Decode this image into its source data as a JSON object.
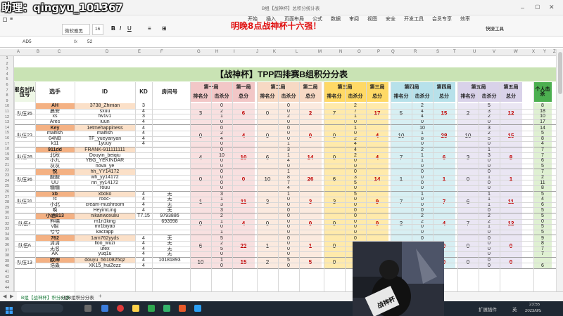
{
  "overlay": {
    "handle": "助理：qingyu_101367",
    "banner": "明晚8点战神杯十六强！"
  },
  "window": {
    "title": "B组【战神杯】总积分统计表",
    "menu": [
      "开始",
      "插入",
      "页面布局",
      "公式",
      "数据",
      "审阅",
      "视图",
      "安全",
      "开发工具",
      "会员专享",
      "效率"
    ]
  },
  "ribbon": {
    "font_name": "微软雅黑",
    "font_size": "16",
    "quick_tools": "快捷工具"
  },
  "formula_bar": {
    "cell_ref": "AD5",
    "fx": "fx",
    "value": "52"
  },
  "columns": [
    "A",
    "B",
    "C",
    "D",
    "E",
    "F",
    "G",
    "H",
    "I",
    "J",
    "K",
    "L",
    "M",
    "N",
    "O",
    "P",
    "Q",
    "R",
    "S",
    "T",
    "U",
    "V",
    "W",
    "X",
    "Y",
    "Z"
  ],
  "rows": [
    "1",
    "2",
    "3",
    "4",
    "5",
    "6",
    "7",
    "8",
    "9",
    "10",
    "11",
    "12",
    "13",
    "14",
    "15",
    "16",
    "17",
    "18",
    "19",
    "20",
    "21",
    "22",
    "23",
    "24",
    "25",
    "26",
    "27",
    "28",
    "29",
    "30",
    "31",
    "32",
    "33",
    "34",
    "35",
    "36",
    "37",
    "38",
    "39",
    "40",
    "41",
    "42",
    "43",
    "44"
  ],
  "sheet": {
    "title": "【战神杯】TPP四排赛B组积分分表",
    "headers": {
      "team_no": "报名时队伍号",
      "player": "选手",
      "id": "ID",
      "kd": "KD",
      "room": "房间号",
      "r1": "第一局",
      "r2": "第二局",
      "r3": "第三局",
      "r4": "第四局",
      "r5": "第五局",
      "rank_pts": "排名分",
      "kill_pts": "击杀分",
      "total": "总分",
      "personal": "个人击杀"
    },
    "teams": [
      {
        "name": "队伍35",
        "players": [
          [
            "AH",
            "3738_Zhinian",
            "3",
            ""
          ],
          [
            "晨安",
            "sxuu",
            "4",
            ""
          ],
          [
            "xs",
            "fw1v1",
            "3",
            ""
          ],
          [
            "Ares",
            "iuun",
            "4",
            ""
          ]
        ],
        "rounds": [
          [
            "3",
            "0 2 1 0",
            "6"
          ],
          [
            "0",
            "0 0 2 0",
            "2"
          ],
          [
            "7",
            "2 7 1 0",
            "17"
          ],
          [
            "5",
            "2 4 4 0",
            "15"
          ],
          [
            "2",
            "5 3 2 0",
            "12"
          ]
        ],
        "personal": [
          "8",
          "18",
          "10",
          "17"
        ]
      },
      {
        "name": "队伍23",
        "players": [
          [
            "Key",
            "1etmehappiness",
            "4",
            ""
          ],
          [
            "malfish",
            "malfish",
            "4",
            ""
          ],
          [
            "04NB",
            "TF_yueyanyan",
            "4",
            ""
          ],
          [
            "k11",
            "1yuuy",
            "4",
            ""
          ]
        ],
        "rounds": [
          [
            "0",
            "0 2 4 0",
            "4"
          ],
          [
            "0",
            "0 0 0 1",
            "0"
          ],
          [
            "0",
            "1 0 2 4",
            "4"
          ],
          [
            "10",
            "10 1 8 0",
            "28"
          ],
          [
            "10",
            "3 2 5 0",
            "15"
          ]
        ],
        "personal": [
          "14",
          "5",
          "8",
          "4"
        ]
      },
      {
        "name": "队伍28",
        "players": [
          [
            "911dd",
            "FRANK-911111111",
            "",
            ""
          ],
          [
            "北秋",
            "Douyin_beiqiu",
            "",
            ""
          ],
          [
            "小九",
            "YBG_YEKINDAR",
            "",
            ""
          ],
          [
            "灰灰",
            "nova_ye",
            "",
            ""
          ]
        ],
        "rounds": [
          [
            "4",
            "0 10 0 0",
            "10"
          ],
          [
            "6",
            "3 1 4 0",
            "14"
          ],
          [
            "0",
            "4 2 0 0",
            "4"
          ],
          [
            "7",
            "2 1 1 0",
            "6"
          ],
          [
            "3",
            "1 3 0 0",
            "8"
          ]
        ],
        "personal": [
          "7",
          "7",
          "6",
          "5"
        ]
      },
      {
        "name": "队伍36",
        "players": [
          [
            "悦",
            "hh_YY14172",
            "",
            ""
          ],
          [
            "酸酸",
            "wh_yy14172",
            "",
            ""
          ],
          [
            "UU",
            "nn_yy14172",
            "",
            ""
          ],
          [
            "糖糖",
            "rouu",
            "",
            ""
          ]
        ],
        "rounds": [
          [
            "0",
            "0 0 0 0",
            "0"
          ],
          [
            "10",
            "1 8 7 4",
            "26"
          ],
          [
            "6",
            "0 3 5 0",
            "14"
          ],
          [
            "1",
            "0 0 0 0",
            "1"
          ],
          [
            "0",
            "0 1 0 0",
            "1"
          ]
        ],
        "personal": [
          "7",
          "2",
          "11",
          "8"
        ]
      },
      {
        "name": "队伍31",
        "players": [
          [
            "xb",
            "xboko",
            "4",
            "无"
          ],
          [
            "rc",
            "rooc-",
            "4",
            "无"
          ],
          [
            "小北",
            "cream-mushroom",
            "4",
            "无"
          ],
          [
            "唤",
            "HeyimLing",
            "4",
            "无"
          ]
        ],
        "rounds": [
          [
            "1",
            "3 1 3 3",
            "11"
          ],
          [
            "3",
            "1 0 0 0",
            "3"
          ],
          [
            "3",
            "5 0 0 0",
            "9"
          ],
          [
            "7",
            "1 0 0 0",
            "7"
          ],
          [
            "6",
            "1 1 1 0",
            "11"
          ]
        ],
        "personal": [
          "5",
          "4",
          "6",
          "5"
        ]
      },
      {
        "name": "队伍4",
        "players": [
          [
            "小酒813",
            "nikanwoxuliu",
            "T7.15",
            "9793886"
          ],
          [
            "熊猫",
            "m1n1king",
            "",
            "693998"
          ],
          [
            "v姐",
            "mr1biyao",
            "",
            ""
          ],
          [
            "兮兮",
            "kacrapp",
            "",
            ""
          ]
        ],
        "rounds": [
          [
            "0",
            "2 1 0 1",
            "4"
          ],
          [
            "0",
            "0 0 0 0",
            "0"
          ],
          [
            "0",
            "0 0 0 0",
            "0"
          ],
          [
            "2",
            "2 2 0 0",
            "4"
          ],
          [
            "7",
            "2 2 1 0",
            "12"
          ]
        ],
        "personal": [
          "5",
          "0",
          "5",
          "5"
        ]
      },
      {
        "name": "队伍6",
        "players": [
          [
            "762",
            "1am762yyds",
            "4",
            "无"
          ],
          [
            "清清",
            "lloo_wuzi",
            "4",
            "无"
          ],
          [
            "无名",
            "ufex",
            "4",
            "无"
          ],
          [
            "AK",
            "yuq1u",
            "4",
            "无"
          ]
        ],
        "rounds": [
          [
            "6",
            "5 2 5 0",
            "22"
          ],
          [
            "1",
            "0 0 0 0",
            "1"
          ],
          [
            "0",
            "0 0 0 0",
            "0"
          ],
          [
            "0",
            "0 0 0 0",
            "0"
          ],
          [
            "0",
            "0 0 0 0",
            "0"
          ]
        ],
        "personal": [
          "9",
          "8",
          "7",
          "7"
        ]
      },
      {
        "name": "队伍13",
        "players": [
          [
            "欧神",
            "douyu_5610825qz",
            "4",
            "10181893"
          ],
          [
            "浩淼",
            "XK15_huiZezz",
            "4",
            ""
          ]
        ],
        "rounds": [
          [
            "10",
            "1 0",
            "15"
          ],
          [
            "2",
            "5 0",
            "5"
          ],
          [
            "0",
            "0 0",
            "0"
          ],
          [
            "0",
            "0 0",
            "0"
          ],
          [
            "0",
            "0 0",
            "0"
          ]
        ],
        "personal": [
          "",
          "6"
        ]
      }
    ]
  },
  "sheet_tabs": [
    "B组【战神杯】积分分表",
    "A组B组积分分表"
  ],
  "taskbar": {
    "status": "扩展插件",
    "lang": "英",
    "time": "23:55",
    "date": "2023/8/5"
  },
  "colors": {
    "title_bar_green": "#c9e3b4",
    "r1_pink": "#f2c7c7",
    "r2_peach": "#f7d9c4",
    "r3_yellow": "#ffd966",
    "r4_cyan": "#b7e1ea",
    "r5_lavender": "#d9d2e9",
    "personal_green": "#4caf50",
    "header_orange": "#f4b183",
    "banner_red": "#e01010"
  }
}
